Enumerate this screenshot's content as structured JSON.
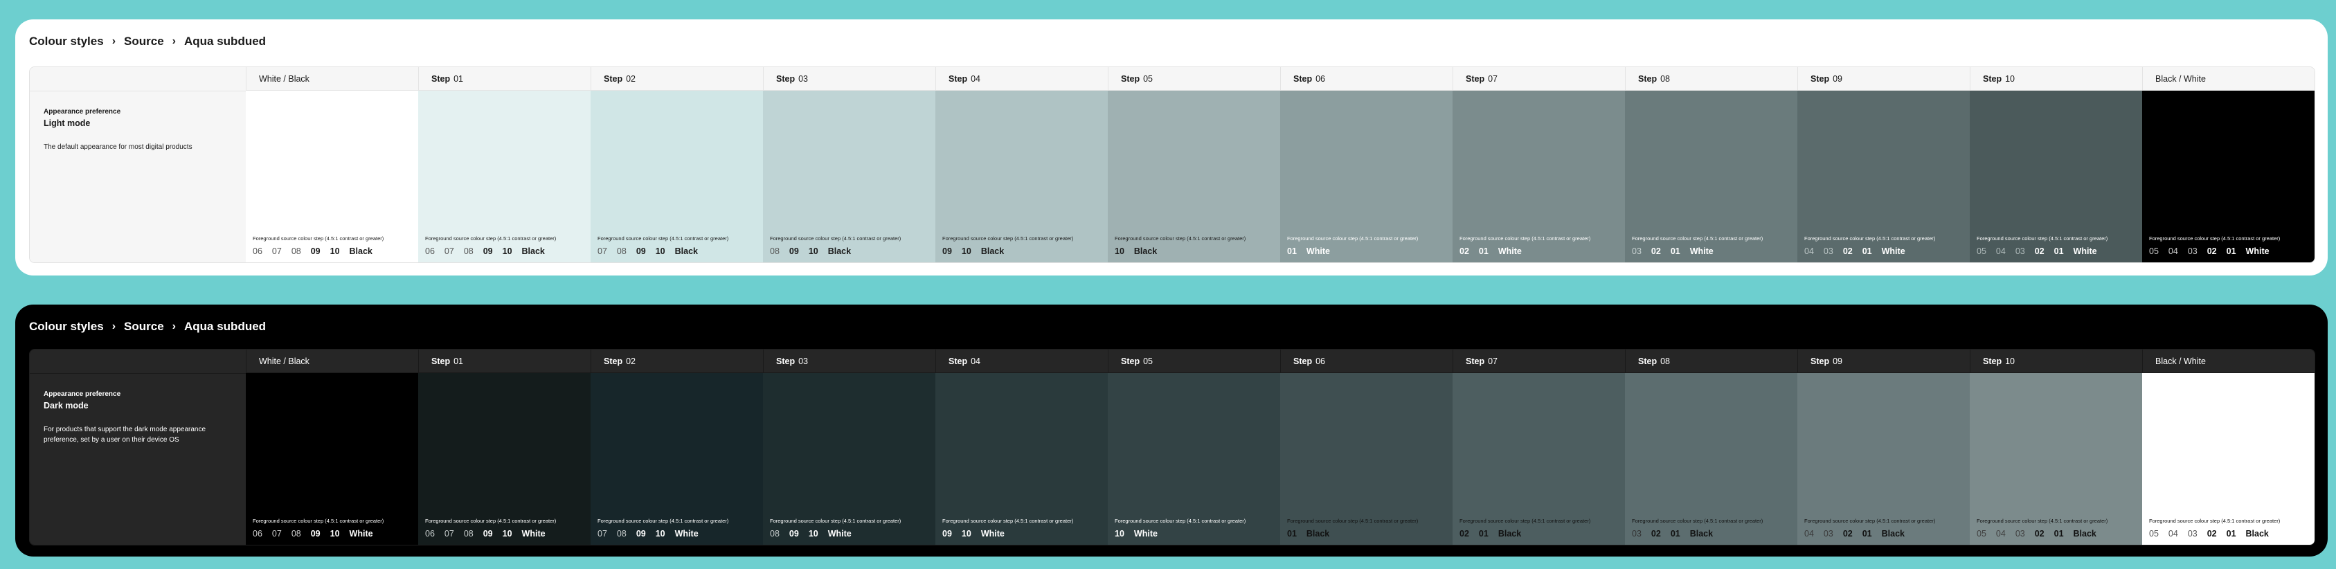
{
  "breadcrumb": [
    "Colour styles",
    "Source",
    "Aqua subdued"
  ],
  "caption": "Foreground source colour step (4.5:1 contrast or greater)",
  "light": {
    "pref_label": "Appearance preference",
    "mode": "Light mode",
    "description": "The default appearance for most digital products",
    "columns": [
      {
        "bold": "",
        "label": "White / Black",
        "bg": "#ffffff",
        "text": "#1a1a1a",
        "dim": "#555555",
        "steps": [
          "06",
          "07",
          "08",
          "09",
          "10"
        ],
        "bw": "Black"
      },
      {
        "bold": "Step",
        "label": "01",
        "bg": "#e4f1f1",
        "text": "#1a1a1a",
        "dim": "#555555",
        "steps": [
          "06",
          "07",
          "08",
          "09",
          "10"
        ],
        "bw": "Black"
      },
      {
        "bold": "Step",
        "label": "02",
        "bg": "#d0e6e6",
        "text": "#1a1a1a",
        "dim": "#555555",
        "steps": [
          "07",
          "08",
          "09",
          "10"
        ],
        "bw": "Black"
      },
      {
        "bold": "Step",
        "label": "03",
        "bg": "#bfd4d5",
        "text": "#1a1a1a",
        "dim": "#555555",
        "steps": [
          "08",
          "09",
          "10"
        ],
        "bw": "Black"
      },
      {
        "bold": "Step",
        "label": "04",
        "bg": "#afc3c4",
        "text": "#1a1a1a",
        "dim": "#555555",
        "steps": [
          "09",
          "10"
        ],
        "bw": "Black"
      },
      {
        "bold": "Step",
        "label": "05",
        "bg": "#9fb1b2",
        "text": "#1a1a1a",
        "dim": "#555555",
        "steps": [
          "10"
        ],
        "bw": "Black"
      },
      {
        "bold": "Step",
        "label": "06",
        "bg": "#8c9e9f",
        "text": "#ffffff",
        "dim": "#e0e6e6",
        "steps": [
          "01"
        ],
        "bw": "White"
      },
      {
        "bold": "Step",
        "label": "07",
        "bg": "#7b8c8d",
        "text": "#ffffff",
        "dim": "#d6dede",
        "steps": [
          "02",
          "01"
        ],
        "bw": "White"
      },
      {
        "bold": "Step",
        "label": "08",
        "bg": "#6a7b7c",
        "text": "#ffffff",
        "dim": "#c8d2d2",
        "steps": [
          "03",
          "02",
          "01"
        ],
        "bw": "White"
      },
      {
        "bold": "Step",
        "label": "09",
        "bg": "#5b6b6c",
        "text": "#ffffff",
        "dim": "#bcc6c6",
        "steps": [
          "04",
          "03",
          "02",
          "01"
        ],
        "bw": "White"
      },
      {
        "bold": "Step",
        "label": "10",
        "bg": "#4b5a5b",
        "text": "#ffffff",
        "dim": "#b0bbbb",
        "steps": [
          "05",
          "04",
          "03",
          "02",
          "01"
        ],
        "bw": "White"
      },
      {
        "bold": "",
        "label": "Black / White",
        "bg": "#000000",
        "text": "#ffffff",
        "dim": "#cccccc",
        "steps": [
          "05",
          "04",
          "03",
          "02",
          "01"
        ],
        "bw": "White"
      }
    ]
  },
  "dark": {
    "pref_label": "Appearance preference",
    "mode": "Dark mode",
    "description": "For products that support the dark mode appearance preference, set by a user on their device OS",
    "columns": [
      {
        "bold": "",
        "label": "White / Black",
        "bg": "#000000",
        "text": "#ffffff",
        "dim": "#cccccc",
        "steps": [
          "06",
          "07",
          "08",
          "09",
          "10"
        ],
        "bw": "White"
      },
      {
        "bold": "Step",
        "label": "01",
        "bg": "#141c1c",
        "text": "#ffffff",
        "dim": "#c6cccc",
        "steps": [
          "06",
          "07",
          "08",
          "09",
          "10"
        ],
        "bw": "White"
      },
      {
        "bold": "Step",
        "label": "02",
        "bg": "#17262a",
        "text": "#ffffff",
        "dim": "#c6cccc",
        "steps": [
          "07",
          "08",
          "09",
          "10"
        ],
        "bw": "White"
      },
      {
        "bold": "Step",
        "label": "03",
        "bg": "#1e2d2f",
        "text": "#ffffff",
        "dim": "#c6cccc",
        "steps": [
          "08",
          "09",
          "10"
        ],
        "bw": "White"
      },
      {
        "bold": "Step",
        "label": "04",
        "bg": "#2a3a3c",
        "text": "#ffffff",
        "dim": "#c6cccc",
        "steps": [
          "09",
          "10"
        ],
        "bw": "White"
      },
      {
        "bold": "Step",
        "label": "05",
        "bg": "#334345",
        "text": "#ffffff",
        "dim": "#c6cccc",
        "steps": [
          "10"
        ],
        "bw": "White"
      },
      {
        "bold": "Step",
        "label": "06",
        "bg": "#3f4f51",
        "text": "#111111",
        "dim": "#222222",
        "steps": [
          "01"
        ],
        "bw": "Black"
      },
      {
        "bold": "Step",
        "label": "07",
        "bg": "#4d5e60",
        "text": "#111111",
        "dim": "#2a2a2a",
        "steps": [
          "02",
          "01"
        ],
        "bw": "Black"
      },
      {
        "bold": "Step",
        "label": "08",
        "bg": "#5c6d6f",
        "text": "#111111",
        "dim": "#333333",
        "steps": [
          "03",
          "02",
          "01"
        ],
        "bw": "Black"
      },
      {
        "bold": "Step",
        "label": "09",
        "bg": "#6b7b7d",
        "text": "#111111",
        "dim": "#3a3a3a",
        "steps": [
          "04",
          "03",
          "02",
          "01"
        ],
        "bw": "Black"
      },
      {
        "bold": "Step",
        "label": "10",
        "bg": "#7c8b8c",
        "text": "#111111",
        "dim": "#404040",
        "steps": [
          "05",
          "04",
          "03",
          "02",
          "01"
        ],
        "bw": "Black"
      },
      {
        "bold": "",
        "label": "Black / White",
        "bg": "#ffffff",
        "text": "#111111",
        "dim": "#555555",
        "steps": [
          "05",
          "04",
          "03",
          "02",
          "01"
        ],
        "bw": "Black"
      }
    ]
  }
}
